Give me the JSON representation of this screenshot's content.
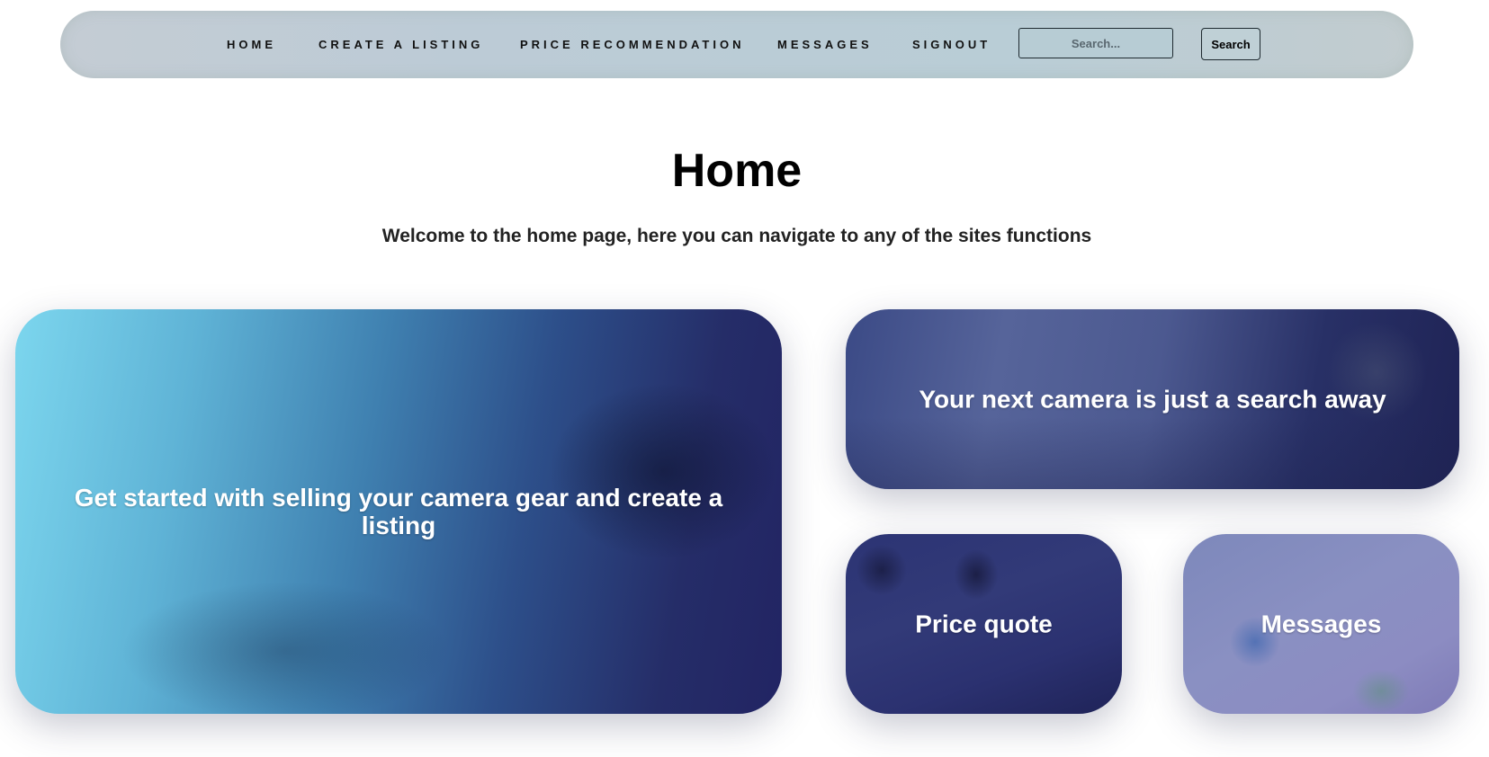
{
  "nav": {
    "home": "HOME",
    "create_listing": "CREATE A LISTING",
    "price_recommendation": "PRICE RECOMMENDATION",
    "messages": "MESSAGES",
    "signout": "SIGNOUT",
    "search_placeholder": "Search...",
    "search_button": "Search"
  },
  "main": {
    "title": "Home",
    "subtitle": "Welcome to the home page, here you can navigate to any of the sites functions"
  },
  "cards": {
    "sell": "Get started with selling your camera gear and create a listing",
    "search": "Your next camera is just a search away",
    "price": "Price quote",
    "messages": "Messages"
  },
  "colors": {
    "navbar": "#bdcbd5",
    "card_overlay_dark": "#222463",
    "card_overlay_light": "#7cd6ee",
    "text_on_card": "#ffffff"
  }
}
